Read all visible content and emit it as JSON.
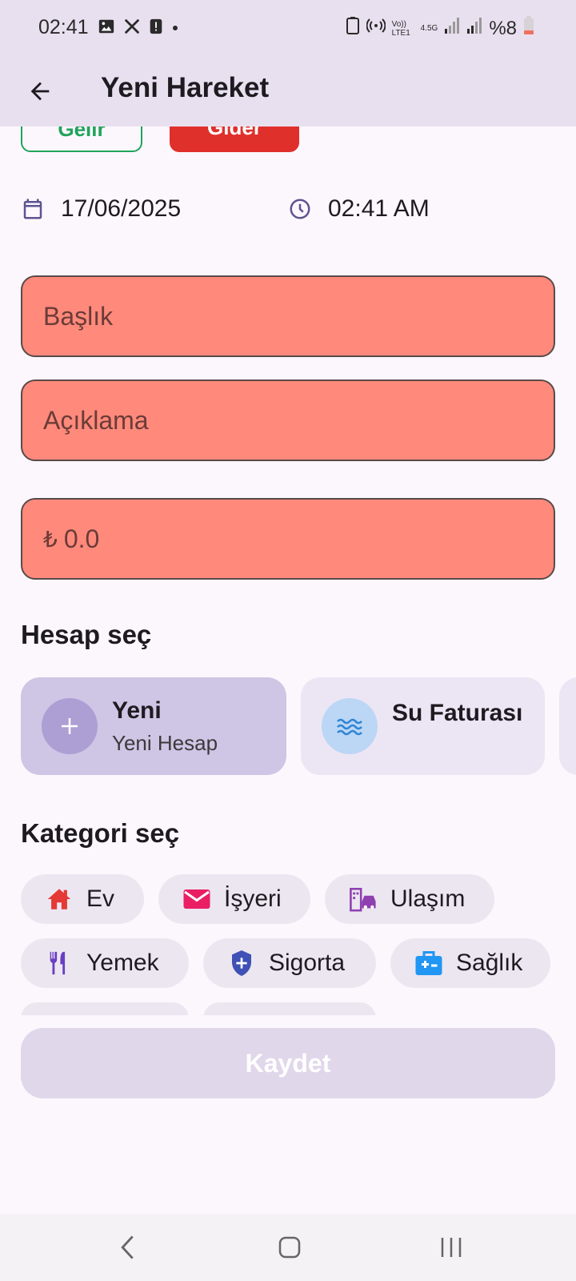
{
  "status_bar": {
    "time": "02:41",
    "battery": "%8",
    "network_volte": "Vo)) LTE1",
    "network_gen": "4.5G"
  },
  "app_bar": {
    "title": "Yeni Hareket"
  },
  "type_toggle": {
    "income_label": "Gelir",
    "expense_label": "Gider",
    "selected": "expense"
  },
  "datetime": {
    "date": "17/06/2025",
    "time": "02:41 AM"
  },
  "form": {
    "title_placeholder": "Başlık",
    "description_placeholder": "Açıklama",
    "currency_symbol": "₺",
    "amount_value": "0.0"
  },
  "account_section": {
    "title": "Hesap seç",
    "accounts": [
      {
        "name": "Yeni",
        "subtitle": "Yeni Hesap",
        "icon": "plus-icon"
      },
      {
        "name": "Su Faturası",
        "subtitle": "",
        "icon": "water-icon"
      }
    ]
  },
  "category_section": {
    "title": "Kategori seç",
    "categories": [
      {
        "label": "Ev",
        "icon": "house-icon",
        "color": "#e53935"
      },
      {
        "label": "İşyeri",
        "icon": "mail-icon",
        "color": "#e91e63"
      },
      {
        "label": "Ulaşım",
        "icon": "transport-icon",
        "color": "#8e3fb0"
      },
      {
        "label": "Yemek",
        "icon": "restaurant-icon",
        "color": "#6a3fc1"
      },
      {
        "label": "Sigorta",
        "icon": "shield-icon",
        "color": "#3f51b5"
      },
      {
        "label": "Sağlık",
        "icon": "medical-kit-icon",
        "color": "#2196f3"
      }
    ]
  },
  "save_button": {
    "label": "Kaydet"
  },
  "colors": {
    "app_bar_bg": "#e9e0ef",
    "field_bg": "#ff8a7b",
    "income": "#20a35a",
    "expense": "#e0302b",
    "accent": "#6b5b95"
  }
}
